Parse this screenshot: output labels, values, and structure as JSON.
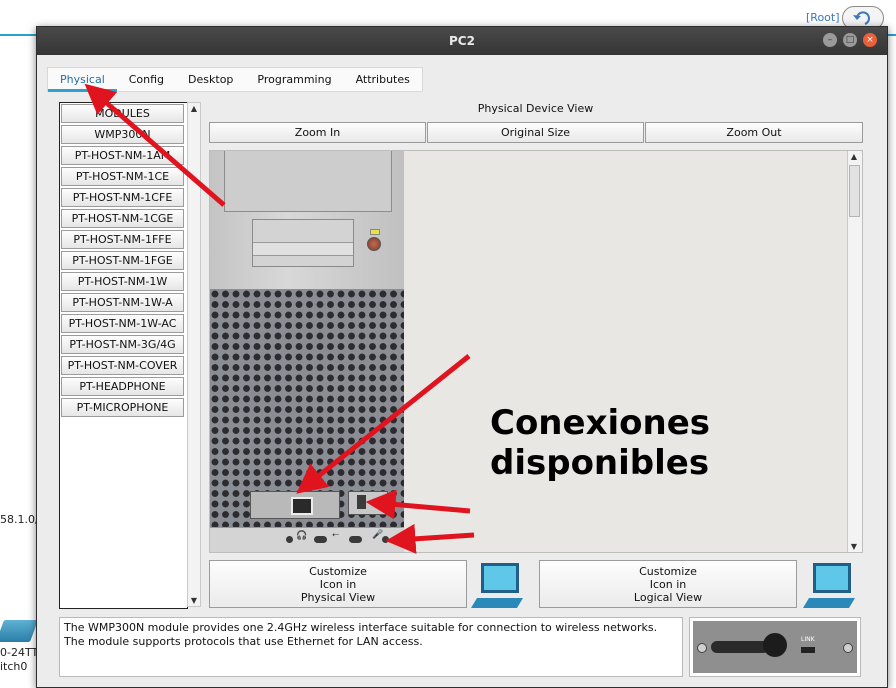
{
  "background": {
    "root_label": "[Root]",
    "undo_icon": "undo-icon",
    "label_ip": "58.1.0/",
    "label_switch_model": "0-24TT",
    "label_switch_name": "itch0"
  },
  "window": {
    "title": "PC2",
    "controls": [
      "minimize-icon",
      "maximize-icon",
      "close-icon"
    ]
  },
  "tabs": [
    {
      "label": "Physical",
      "active": true
    },
    {
      "label": "Config"
    },
    {
      "label": "Desktop"
    },
    {
      "label": "Programming"
    },
    {
      "label": "Attributes"
    }
  ],
  "modules": {
    "header": "MODULES",
    "items": [
      "WMP300N",
      "PT-HOST-NM-1AM",
      "PT-HOST-NM-1CE",
      "PT-HOST-NM-1CFE",
      "PT-HOST-NM-1CGE",
      "PT-HOST-NM-1FFE",
      "PT-HOST-NM-1FGE",
      "PT-HOST-NM-1W",
      "PT-HOST-NM-1W-A",
      "PT-HOST-NM-1W-AC",
      "PT-HOST-NM-3G/4G",
      "PT-HOST-NM-COVER",
      "PT-HEADPHONE",
      "PT-MICROPHONE"
    ]
  },
  "physical_view": {
    "label": "Physical Device View",
    "zoom_in": "Zoom In",
    "original_size": "Original Size",
    "zoom_out": "Zoom Out"
  },
  "annotation": {
    "line1": "Conexiones",
    "line2": "disponibles",
    "arrow_color": "#e0141e"
  },
  "customize": {
    "physical": {
      "line1": "Customize",
      "line2": "Icon in",
      "line3": "Physical View"
    },
    "logical": {
      "line1": "Customize",
      "line2": "Icon in",
      "line3": "Logical View"
    }
  },
  "info": {
    "line1": "The WMP300N module provides one 2.4GHz wireless interface suitable for connection to wireless networks.",
    "line2": "The module supports protocols that use Ethernet for LAN access.",
    "thumb_label": "LINK"
  },
  "colors": {
    "accent": "#2f9fd0",
    "title_bar": "#3d3d3d"
  }
}
